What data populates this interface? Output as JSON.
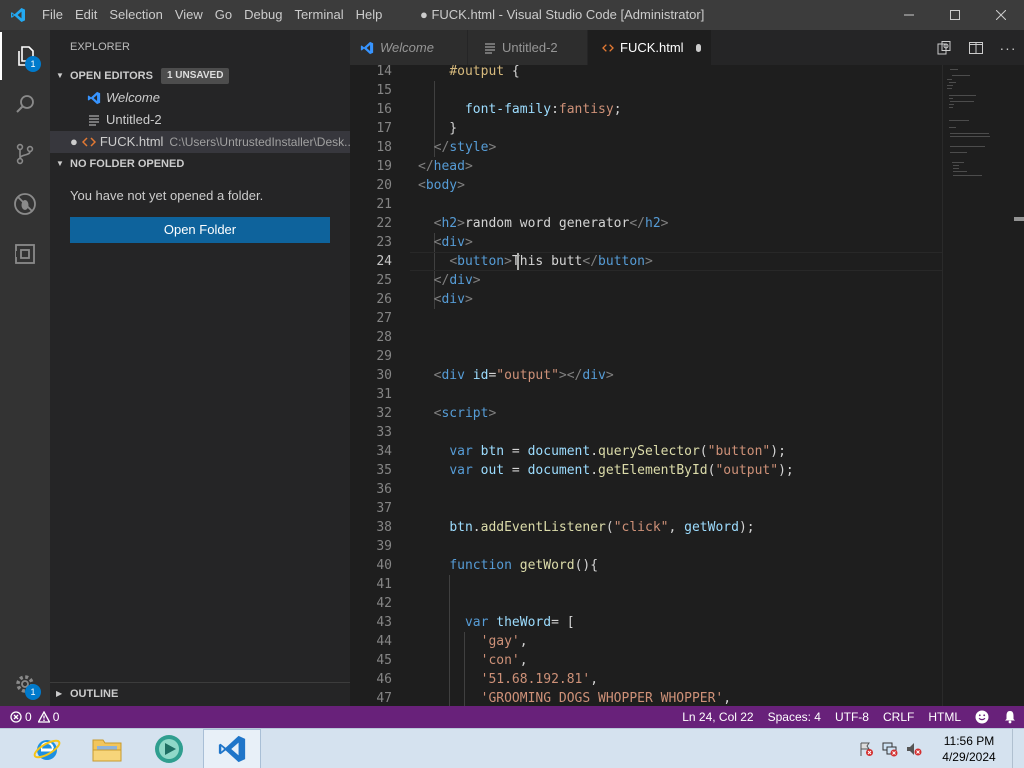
{
  "window": {
    "title": "● FUCK.html - Visual Studio Code [Administrator]",
    "menu": [
      "File",
      "Edit",
      "Selection",
      "View",
      "Go",
      "Debug",
      "Terminal",
      "Help"
    ]
  },
  "activity_bar": {
    "explorer_badge": "1",
    "manage_badge": "1"
  },
  "sidebar": {
    "title": "EXPLORER",
    "open_editors": {
      "header": "OPEN EDITORS",
      "badge": "1 UNSAVED",
      "items": [
        {
          "name": "Welcome",
          "path": ""
        },
        {
          "name": "Untitled-2",
          "path": ""
        },
        {
          "name": "FUCK.html",
          "path": "C:\\Users\\UntrustedInstaller\\Desk..."
        }
      ]
    },
    "no_folder": {
      "header": "NO FOLDER OPENED",
      "message": "You have not yet opened a folder.",
      "button": "Open Folder"
    },
    "outline_header": "OUTLINE"
  },
  "tabs": [
    {
      "label": "Welcome",
      "active": false
    },
    {
      "label": "Untitled-2",
      "active": false
    },
    {
      "label": "FUCK.html",
      "active": true,
      "modified": true
    }
  ],
  "editor": {
    "current_line": 24,
    "lines": [
      {
        "n": "14",
        "tokens": [
          [
            "    ",
            "txt"
          ],
          [
            "#output",
            "sel"
          ],
          [
            " {",
            "txt"
          ]
        ]
      },
      {
        "n": "15",
        "tokens": []
      },
      {
        "n": "16",
        "tokens": [
          [
            "      ",
            "txt"
          ],
          [
            "font-family",
            "attr"
          ],
          [
            ":",
            "txt"
          ],
          [
            "fantisy",
            "str"
          ],
          [
            ";",
            "txt"
          ]
        ]
      },
      {
        "n": "17",
        "tokens": [
          [
            "    }",
            "txt"
          ]
        ]
      },
      {
        "n": "18",
        "tokens": [
          [
            "  ",
            "txt"
          ],
          [
            "</",
            "brk"
          ],
          [
            "style",
            "tag"
          ],
          [
            ">",
            "brk"
          ]
        ]
      },
      {
        "n": "19",
        "tokens": [
          [
            "</",
            "brk"
          ],
          [
            "head",
            "tag"
          ],
          [
            ">",
            "brk"
          ]
        ]
      },
      {
        "n": "20",
        "tokens": [
          [
            "<",
            "brk"
          ],
          [
            "body",
            "tag"
          ],
          [
            ">",
            "brk"
          ]
        ]
      },
      {
        "n": "21",
        "tokens": []
      },
      {
        "n": "22",
        "tokens": [
          [
            "  ",
            "txt"
          ],
          [
            "<",
            "brk"
          ],
          [
            "h2",
            "tag"
          ],
          [
            ">",
            "brk"
          ],
          [
            "random word generator",
            "txt"
          ],
          [
            "</",
            "brk"
          ],
          [
            "h2",
            "tag"
          ],
          [
            ">",
            "brk"
          ]
        ]
      },
      {
        "n": "23",
        "tokens": [
          [
            "  ",
            "txt"
          ],
          [
            "<",
            "brk"
          ],
          [
            "div",
            "tag"
          ],
          [
            ">",
            "brk"
          ]
        ]
      },
      {
        "n": "24",
        "tokens": [
          [
            "    ",
            "txt"
          ],
          [
            "<",
            "brk"
          ],
          [
            "button",
            "tag"
          ],
          [
            ">",
            "brk"
          ],
          [
            "This butt",
            "txt"
          ],
          [
            "</",
            "brk"
          ],
          [
            "button",
            "tag"
          ],
          [
            ">",
            "brk"
          ]
        ]
      },
      {
        "n": "25",
        "tokens": [
          [
            "  ",
            "txt"
          ],
          [
            "</",
            "brk"
          ],
          [
            "div",
            "tag"
          ],
          [
            ">",
            "brk"
          ]
        ]
      },
      {
        "n": "26",
        "tokens": [
          [
            "  ",
            "txt"
          ],
          [
            "<",
            "brk"
          ],
          [
            "div",
            "tag"
          ],
          [
            ">",
            "brk"
          ]
        ]
      },
      {
        "n": "27",
        "tokens": []
      },
      {
        "n": "28",
        "tokens": []
      },
      {
        "n": "29",
        "tokens": []
      },
      {
        "n": "30",
        "tokens": [
          [
            "  ",
            "txt"
          ],
          [
            "<",
            "brk"
          ],
          [
            "div",
            "tag"
          ],
          [
            " ",
            "txt"
          ],
          [
            "id",
            "attr"
          ],
          [
            "=",
            "txt"
          ],
          [
            "\"output\"",
            "str"
          ],
          [
            ">",
            "brk"
          ],
          [
            "</",
            "brk"
          ],
          [
            "div",
            "tag"
          ],
          [
            ">",
            "brk"
          ]
        ]
      },
      {
        "n": "31",
        "tokens": []
      },
      {
        "n": "32",
        "tokens": [
          [
            "  ",
            "txt"
          ],
          [
            "<",
            "brk"
          ],
          [
            "script",
            "tag"
          ],
          [
            ">",
            "brk"
          ]
        ]
      },
      {
        "n": "33",
        "tokens": []
      },
      {
        "n": "34",
        "tokens": [
          [
            "    ",
            "txt"
          ],
          [
            "var",
            "kw"
          ],
          [
            " ",
            "txt"
          ],
          [
            "btn",
            "var"
          ],
          [
            " = ",
            "txt"
          ],
          [
            "document",
            "var"
          ],
          [
            ".",
            "txt"
          ],
          [
            "querySelector",
            "fn"
          ],
          [
            "(",
            "txt"
          ],
          [
            "\"button\"",
            "str"
          ],
          [
            ");",
            "txt"
          ]
        ]
      },
      {
        "n": "35",
        "tokens": [
          [
            "    ",
            "txt"
          ],
          [
            "var",
            "kw"
          ],
          [
            " ",
            "txt"
          ],
          [
            "out",
            "var"
          ],
          [
            " = ",
            "txt"
          ],
          [
            "document",
            "var"
          ],
          [
            ".",
            "txt"
          ],
          [
            "getElementById",
            "fn"
          ],
          [
            "(",
            "txt"
          ],
          [
            "\"output\"",
            "str"
          ],
          [
            ");",
            "txt"
          ]
        ]
      },
      {
        "n": "36",
        "tokens": []
      },
      {
        "n": "37",
        "tokens": []
      },
      {
        "n": "38",
        "tokens": [
          [
            "    ",
            "txt"
          ],
          [
            "btn",
            "var"
          ],
          [
            ".",
            "txt"
          ],
          [
            "addEventListener",
            "fn"
          ],
          [
            "(",
            "txt"
          ],
          [
            "\"click\"",
            "str"
          ],
          [
            ", ",
            "txt"
          ],
          [
            "getWord",
            "var"
          ],
          [
            ");",
            "txt"
          ]
        ]
      },
      {
        "n": "39",
        "tokens": []
      },
      {
        "n": "40",
        "tokens": [
          [
            "    ",
            "txt"
          ],
          [
            "function",
            "kw"
          ],
          [
            " ",
            "txt"
          ],
          [
            "getWord",
            "fn"
          ],
          [
            "(){",
            "txt"
          ]
        ]
      },
      {
        "n": "41",
        "tokens": []
      },
      {
        "n": "42",
        "tokens": []
      },
      {
        "n": "43",
        "tokens": [
          [
            "      ",
            "txt"
          ],
          [
            "var",
            "kw"
          ],
          [
            " ",
            "txt"
          ],
          [
            "theWord",
            "var"
          ],
          [
            "= [",
            "txt"
          ]
        ]
      },
      {
        "n": "44",
        "tokens": [
          [
            "        ",
            "txt"
          ],
          [
            "'gay'",
            "str"
          ],
          [
            ",",
            "txt"
          ]
        ]
      },
      {
        "n": "45",
        "tokens": [
          [
            "        ",
            "txt"
          ],
          [
            "'con'",
            "str"
          ],
          [
            ",",
            "txt"
          ]
        ]
      },
      {
        "n": "46",
        "tokens": [
          [
            "        ",
            "txt"
          ],
          [
            "'51.68.192.81'",
            "str"
          ],
          [
            ",",
            "txt"
          ]
        ]
      },
      {
        "n": "47",
        "tokens": [
          [
            "        ",
            "txt"
          ],
          [
            "'GROOMING DOGS WHOPPER WHOPPER'",
            "str"
          ],
          [
            ",",
            "txt"
          ]
        ]
      }
    ]
  },
  "statusbar": {
    "errors": "0",
    "warnings": "0",
    "position": "Ln 24, Col 22",
    "spaces": "Spaces: 4",
    "encoding": "UTF-8",
    "eol": "CRLF",
    "language": "HTML"
  },
  "taskbar": {
    "time": "11:56 PM",
    "date": "4/29/2024"
  },
  "colors": {
    "statusbar": "#68217a",
    "accent": "#007acc",
    "button": "#0e639c"
  }
}
